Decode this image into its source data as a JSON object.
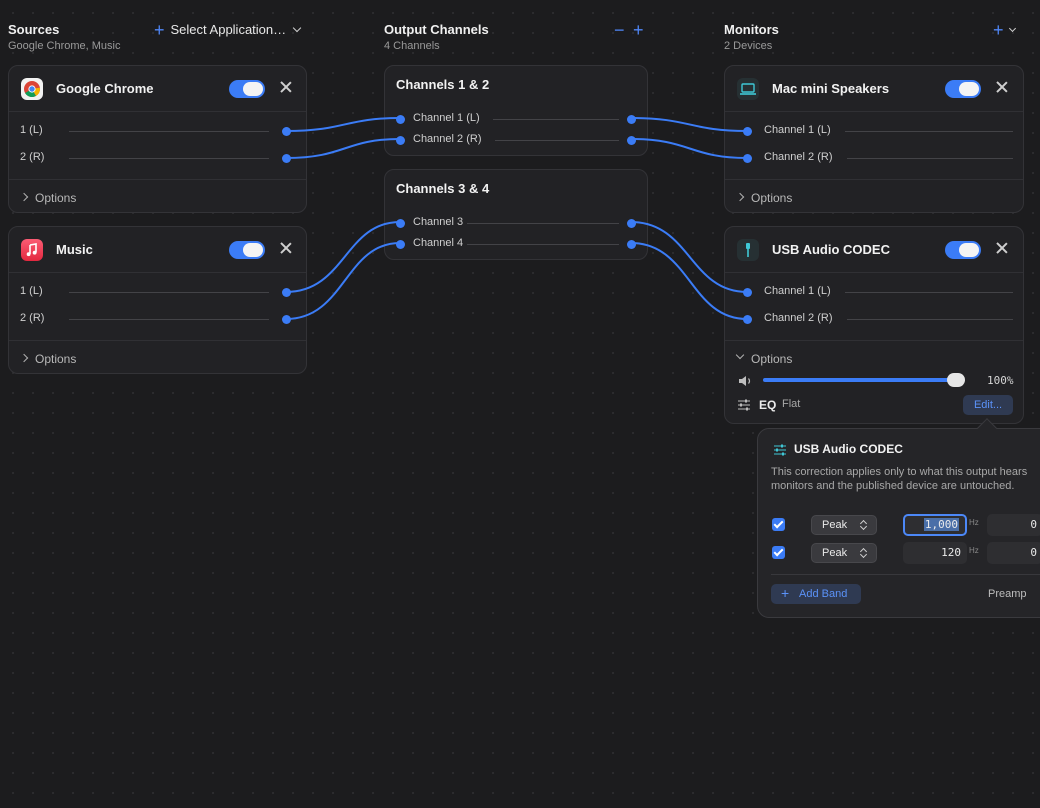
{
  "sources": {
    "title": "Sources",
    "subtitle": "Google Chrome, Music",
    "select_label": "Select Application…",
    "cards": [
      {
        "name": "Google Chrome",
        "icon": "chrome-icon",
        "enabled": true,
        "channels": [
          "1 (L)",
          "2 (R)"
        ],
        "options_label": "Options"
      },
      {
        "name": "Music",
        "icon": "music-icon",
        "enabled": true,
        "channels": [
          "1 (L)",
          "2 (R)"
        ],
        "options_label": "Options"
      }
    ]
  },
  "output": {
    "title": "Output Channels",
    "subtitle": "4 Channels",
    "groups": [
      {
        "title": "Channels 1 & 2",
        "channels": [
          "Channel 1 (L)",
          "Channel 2 (R)"
        ]
      },
      {
        "title": "Channels 3 & 4",
        "channels": [
          "Channel 3",
          "Channel 4"
        ]
      }
    ]
  },
  "monitors": {
    "title": "Monitors",
    "subtitle": "2 Devices",
    "cards": [
      {
        "name": "Mac mini Speakers",
        "icon": "laptop-icon",
        "enabled": true,
        "channels": [
          "Channel 1 (L)",
          "Channel 2 (R)"
        ],
        "options_label": "Options"
      },
      {
        "name": "USB Audio CODEC",
        "icon": "usb-icon",
        "enabled": true,
        "channels": [
          "Channel 1 (L)",
          "Channel 2 (R)"
        ],
        "options_label": "Options",
        "volume": 1.0,
        "volume_label": "100%",
        "eq_label": "EQ",
        "eq_value": "Flat",
        "edit_label": "Edit..."
      }
    ]
  },
  "eq_popup": {
    "title": "USB Audio CODEC",
    "description_line1": "This correction applies only to what this output hears",
    "description_line2": "monitors and the published device are untouched.",
    "bands": [
      {
        "enabled": true,
        "type": "Peak",
        "freq": "1,000",
        "unit": "Hz",
        "gain": "0"
      },
      {
        "enabled": true,
        "type": "Peak",
        "freq": "120",
        "unit": "Hz",
        "gain": "0"
      }
    ],
    "add_band_label": "Add Band",
    "preamp_label": "Preamp"
  },
  "colors": {
    "accent": "#3b7cf6",
    "background": "#1c1c1e",
    "card": "#222225"
  }
}
